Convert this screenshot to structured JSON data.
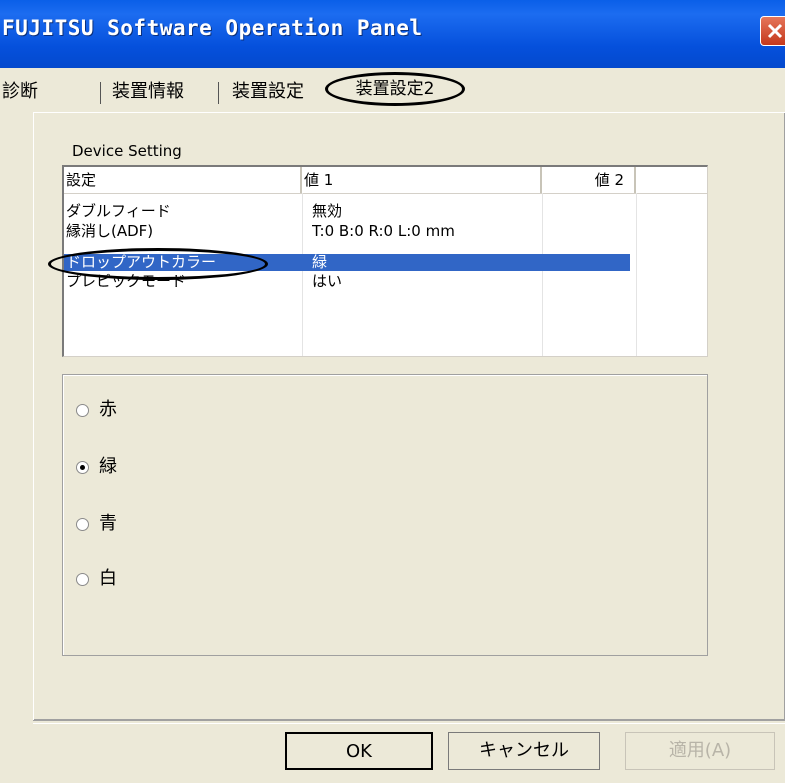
{
  "window": {
    "title": "FUJITSU Software Operation Panel"
  },
  "tabs": [
    {
      "label": "診断"
    },
    {
      "label": "装置情報"
    },
    {
      "label": "装置設定"
    },
    {
      "label": "装置設定2"
    }
  ],
  "group": {
    "label": "Device Setting"
  },
  "table": {
    "columns": [
      "設定",
      "値 1",
      "値 2"
    ],
    "rows": [
      {
        "setting": "ダブルフィード",
        "value1": "無効",
        "value2": ""
      },
      {
        "setting": "縁消し(ADF)",
        "value1": "T:0  B:0  R:0  L:0 mm",
        "value2": ""
      },
      {
        "setting": "ドロップアウトカラー",
        "value1": "緑",
        "value2": "",
        "selected": true
      },
      {
        "setting": "プレピックモード",
        "value1": "はい",
        "value2": ""
      }
    ]
  },
  "radios": [
    {
      "label": "赤",
      "checked": false
    },
    {
      "label": "緑",
      "checked": true
    },
    {
      "label": "青",
      "checked": false
    },
    {
      "label": "白",
      "checked": false
    }
  ],
  "buttons": {
    "ok": "OK",
    "cancel": "キャンセル",
    "apply": "適用(A)"
  },
  "colors": {
    "titlebar": "#0550dc",
    "selection": "#3166c6",
    "face": "#ece9d8"
  }
}
